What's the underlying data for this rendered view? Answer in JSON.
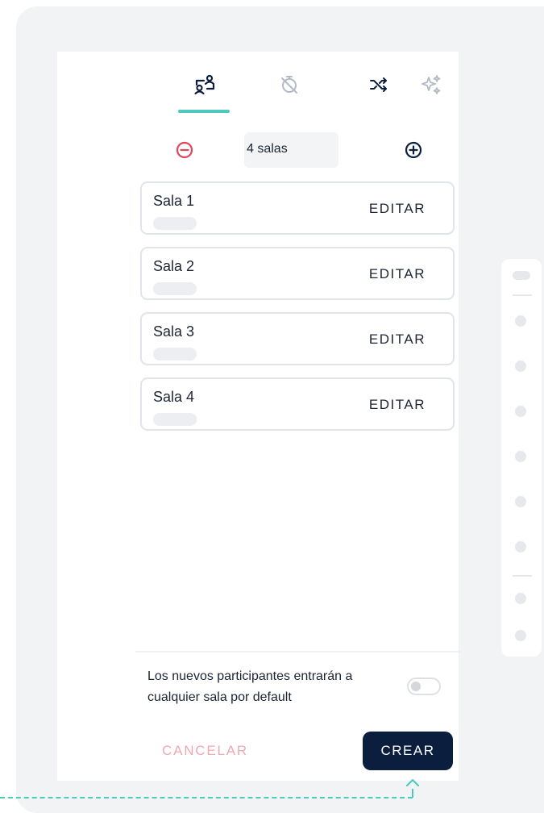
{
  "room_selector": {
    "count_label": "4 salas",
    "decrease_label": "−",
    "increase_label": "+"
  },
  "tabs": [
    {
      "icon": "breakout-rooms-icon",
      "active": true
    },
    {
      "icon": "timer-off-icon",
      "active": false
    },
    {
      "icon": "shuffle-icon",
      "active": false
    },
    {
      "icon": "sparkles-icon",
      "active": false
    }
  ],
  "rooms": [
    {
      "name": "Sala 1",
      "edit_label": "EDITAR"
    },
    {
      "name": "Sala 2",
      "edit_label": "EDITAR"
    },
    {
      "name": "Sala 3",
      "edit_label": "EDITAR"
    },
    {
      "name": "Sala 4",
      "edit_label": "EDITAR"
    }
  ],
  "settings": {
    "default_room_note": "Los nuevos participantes entrarán a cualquier sala por default",
    "toggle_on": false
  },
  "actions": {
    "cancel_label": "CANCELAR",
    "create_label": "CREAR"
  },
  "colors": {
    "accent": "#4ec9bf",
    "primary": "#0c1e3d",
    "danger": "#e0455b",
    "cancel_text": "#f0a9b3"
  }
}
